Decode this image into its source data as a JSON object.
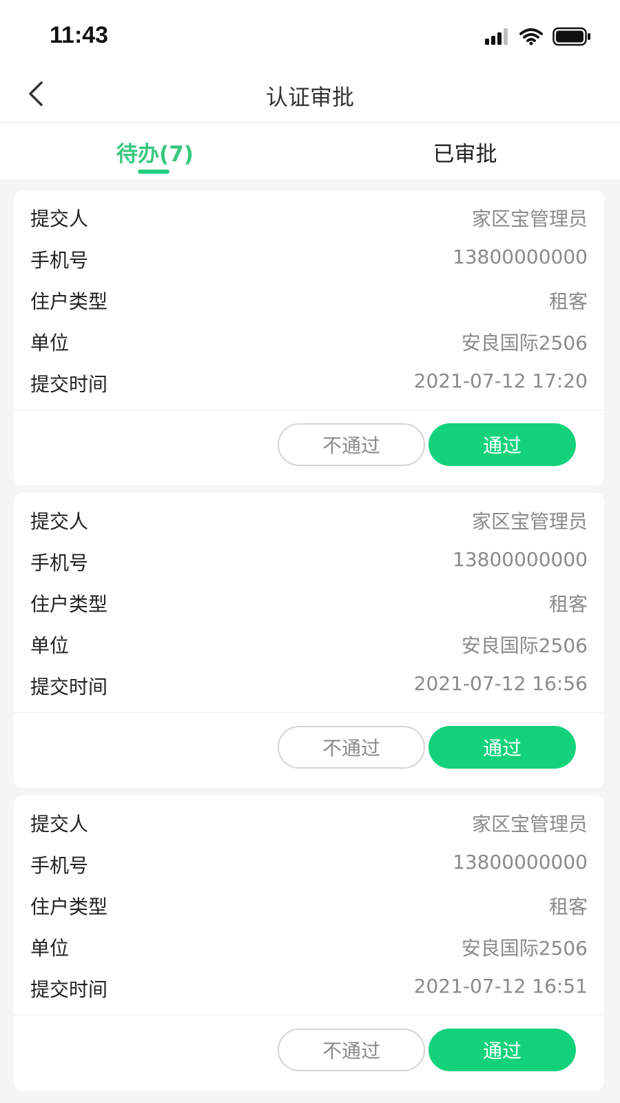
{
  "status_bar": {
    "time": "11:43",
    "icons": [
      "cellular-signal-icon",
      "wifi-icon",
      "battery-icon"
    ]
  },
  "header": {
    "title": "认证审批",
    "back_icon": "chevron-left-icon"
  },
  "tabs": [
    {
      "label": "待办(7)",
      "active": true
    },
    {
      "label": "已审批",
      "active": false
    }
  ],
  "colors": {
    "accent": "#13d27b",
    "tab_active": "#37c77f",
    "background": "#f5f5f5"
  },
  "cards": [
    {
      "fields": [
        {
          "label": "提交人",
          "value": "家区宝管理员"
        },
        {
          "label": "手机号",
          "value": "13800000000"
        },
        {
          "label": "住户类型",
          "value": "租客"
        },
        {
          "label": "单位",
          "value": "安良国际2506"
        },
        {
          "label": "提交时间",
          "value": "2021-07-12 17:20"
        }
      ],
      "reject_label": "不通过",
      "approve_label": "通过"
    },
    {
      "fields": [
        {
          "label": "提交人",
          "value": "家区宝管理员"
        },
        {
          "label": "手机号",
          "value": "13800000000"
        },
        {
          "label": "住户类型",
          "value": "租客"
        },
        {
          "label": "单位",
          "value": "安良国际2506"
        },
        {
          "label": "提交时间",
          "value": "2021-07-12 16:56"
        }
      ],
      "reject_label": "不通过",
      "approve_label": "通过"
    },
    {
      "fields": [
        {
          "label": "提交人",
          "value": "家区宝管理员"
        },
        {
          "label": "手机号",
          "value": "13800000000"
        },
        {
          "label": "住户类型",
          "value": "租客"
        },
        {
          "label": "单位",
          "value": "安良国际2506"
        },
        {
          "label": "提交时间",
          "value": "2021-07-12 16:51"
        }
      ],
      "reject_label": "不通过",
      "approve_label": "通过"
    }
  ]
}
